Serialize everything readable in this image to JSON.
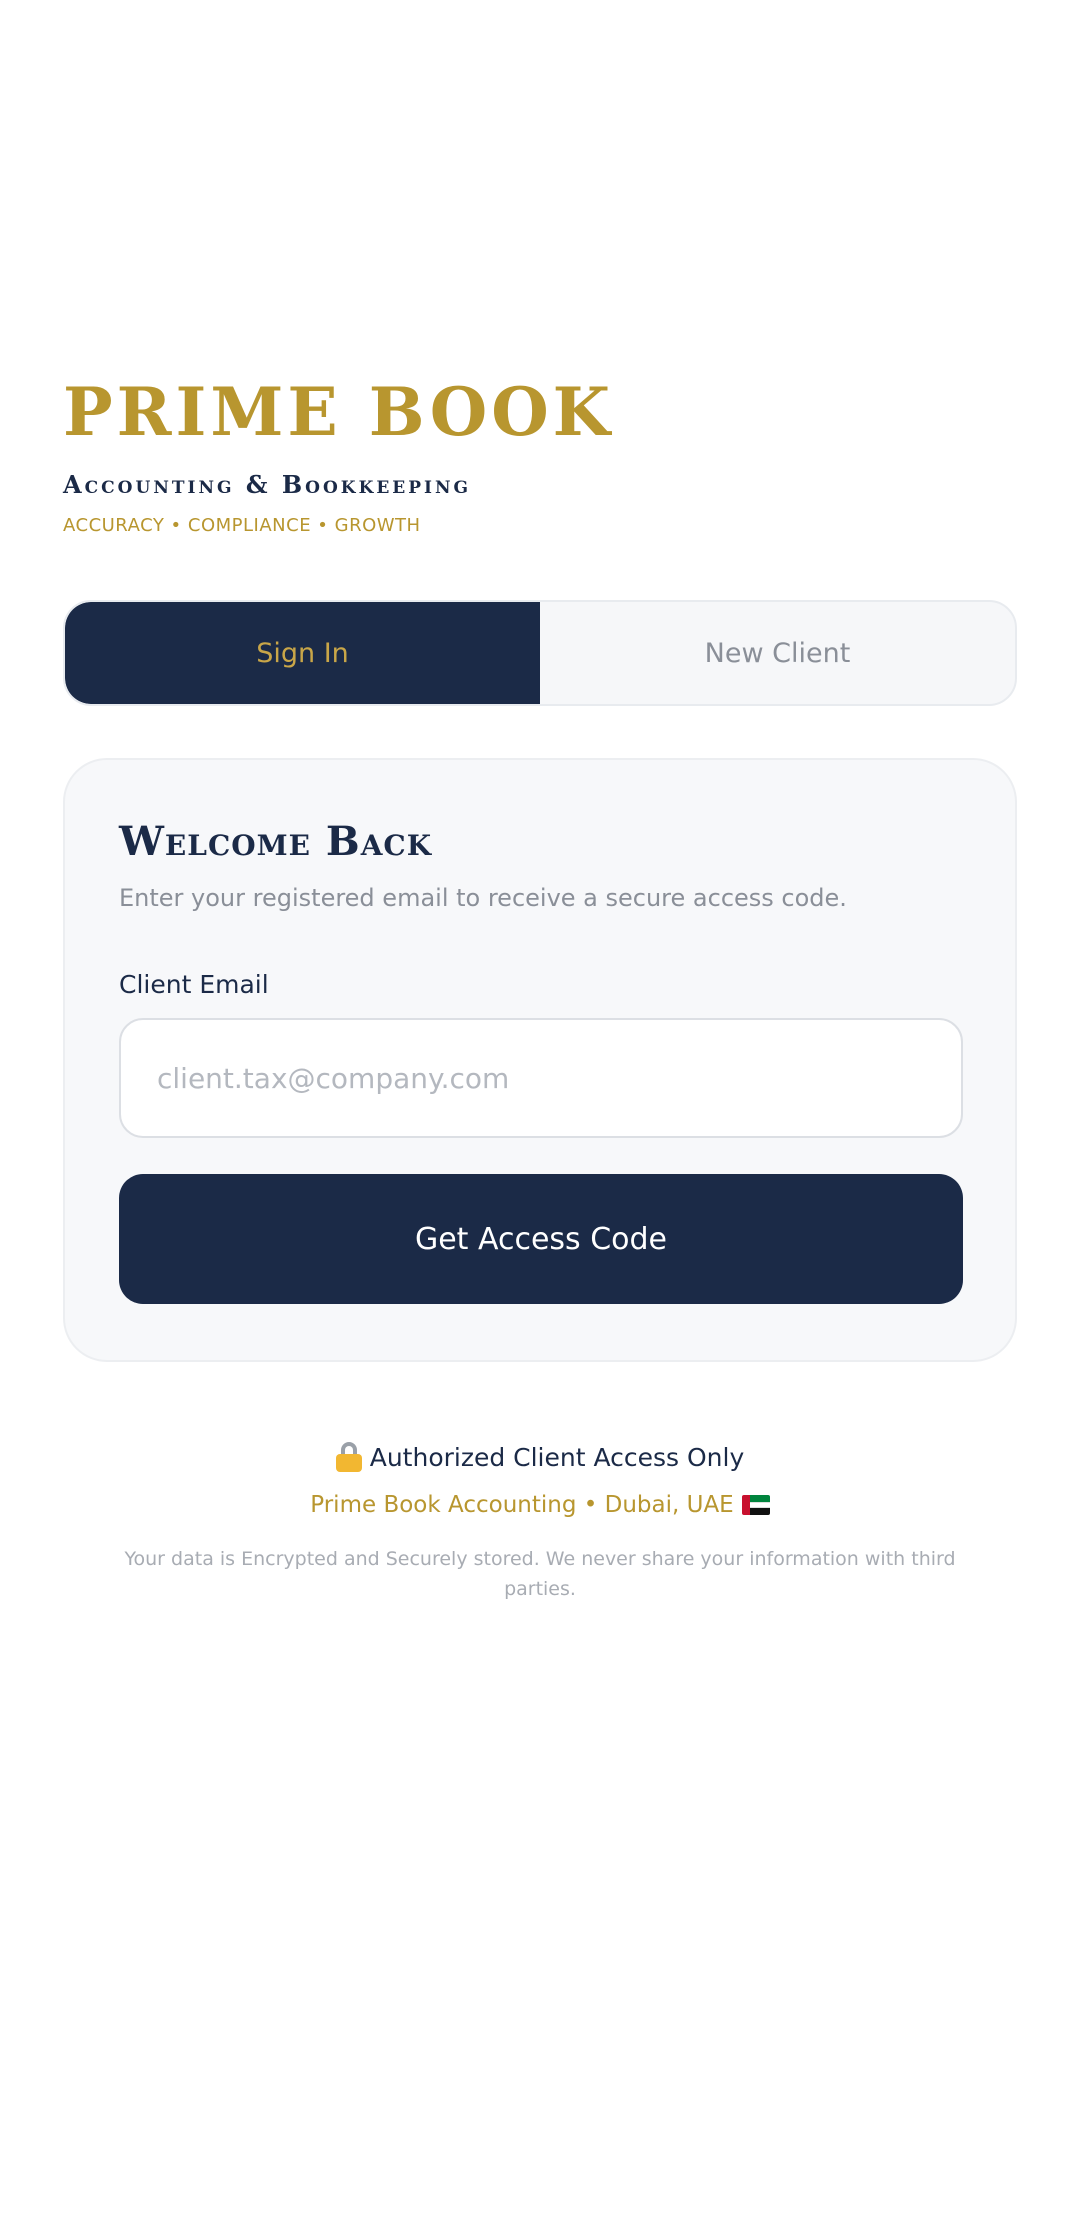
{
  "brand": {
    "title": "PRIME BOOK",
    "subtitle": "Accounting & Bookkeeping",
    "tagline": "ACCURACY • COMPLIANCE • GROWTH",
    "gold": "#b8962f",
    "navy": "#1b2a47"
  },
  "tabs": {
    "sign_in": "Sign In",
    "new_client": "New Client",
    "active": "sign_in"
  },
  "card": {
    "title": "Welcome Back",
    "description": "Enter your registered email to receive a secure access code.",
    "email_label": "Client Email",
    "email_placeholder": "client.tax@company.com",
    "email_value": "",
    "submit_label": "Get Access Code"
  },
  "footer": {
    "lock_icon": "lock-icon",
    "auth_text": "Authorized Client Access Only",
    "company_text": "Prime Book Accounting • Dubai, UAE",
    "flag_icon": "uae-flag-icon",
    "note": "Your data is Encrypted and Securely stored. We never share your information with third parties."
  }
}
